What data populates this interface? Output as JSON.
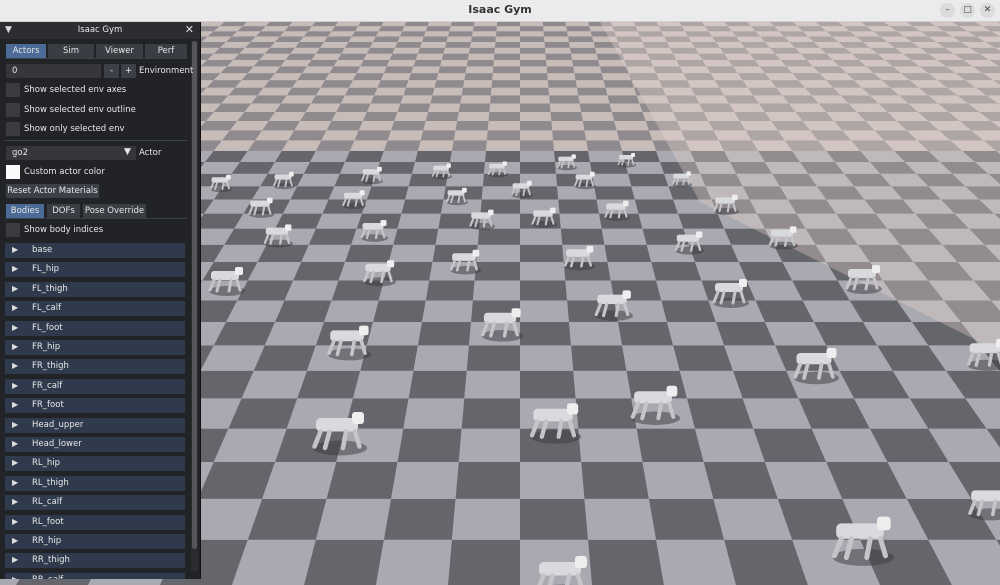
{
  "window": {
    "title": "Isaac Gym",
    "minimize_glyph": "–",
    "maximize_glyph": "□",
    "close_glyph": "✕"
  },
  "panel": {
    "title": "Isaac Gym",
    "collapse_glyph": "▼",
    "close_glyph": "✕",
    "tabs": [
      "Actors",
      "Sim",
      "Viewer",
      "Perf"
    ],
    "active_tab": "Actors",
    "environment": {
      "value": "0",
      "minus_label": "-",
      "plus_label": "+",
      "label": "Environment"
    },
    "checkboxes": [
      {
        "label": "Show selected env axes",
        "checked": false
      },
      {
        "label": "Show selected env outline",
        "checked": false
      },
      {
        "label": "Show only selected env",
        "checked": false
      }
    ],
    "actor": {
      "value": "go2",
      "arrow": "▼",
      "label": "Actor"
    },
    "custom_color": {
      "label": "Custom actor color",
      "checked": false,
      "swatch": "#ffffff"
    },
    "reset_button": "Reset Actor Materials",
    "subtabs": [
      "Bodies",
      "DOFs",
      "Pose Override"
    ],
    "active_subtab": "Bodies",
    "show_indices": {
      "label": "Show body indices",
      "checked": false
    },
    "tree_arrow": "▶",
    "bodies": [
      "base",
      "FL_hip",
      "FL_thigh",
      "FL_calf",
      "FL_foot",
      "FR_hip",
      "FR_thigh",
      "FR_calf",
      "FR_foot",
      "Head_upper",
      "Head_lower",
      "RL_hip",
      "RL_thigh",
      "RL_calf",
      "RL_foot",
      "RR_hip",
      "RR_thigh",
      "RR_calf"
    ]
  },
  "viewport": {
    "scene": "checkered ground plane with many quadruped robots",
    "colors": {
      "light_tile": "#a9a9b1",
      "dark_tile": "#65656c",
      "far_light": "#c8bcb9",
      "far_dark": "#8f8a8e",
      "robot": "#d9dadd"
    }
  }
}
